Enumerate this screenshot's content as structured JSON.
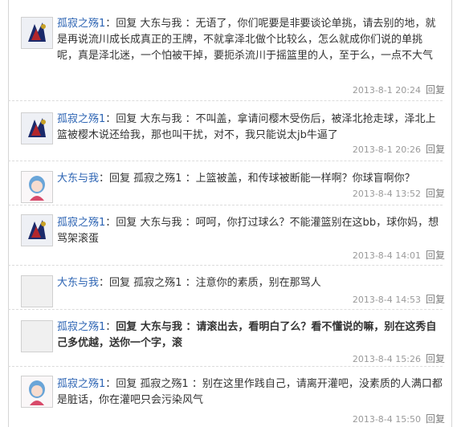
{
  "replies": [
    {
      "author": "孤寂之殇1",
      "text": "回复  大东与我 ：无语了，你们呢要是非要谈论单挑，请去别的地，就是再说流川成长成真正的王牌，不就拿泽北做个比较么，怎么就成你们说的单挑呢，真是泽北迷，一个怕被干掉，要扼杀流川于摇篮里的人，至于么，一点不大气",
      "time": "2013-8-1 20:24",
      "reply_label": "回复",
      "avatar": "art-avatar"
    },
    {
      "author": "孤寂之殇1",
      "text": "回复  大东与我 ：不叫盖，拿请问樱木受伤后，被泽北抢走球，泽北上篮被樱木说还给我，那也叫干扰，对不，我只能说太jb牛逼了",
      "time": "2013-8-1 20:26",
      "reply_label": "回复",
      "avatar": "art-avatar"
    },
    {
      "author": "大东与我",
      "text": "回复  孤寂之殇1 ：上篮被盖，和传球被断能一样啊？你球盲啊你？",
      "time": "2013-8-4 13:52",
      "reply_label": "回复",
      "avatar": "anime-avatar"
    },
    {
      "author": "孤寂之殇1",
      "text": "回复  大东与我 ：呵呵，你打过球么？不能灌篮别在这bb，球你妈，想骂架滚蛋",
      "time": "2013-8-4 14:01",
      "reply_label": "回复",
      "avatar": "art-avatar"
    },
    {
      "author": "大东与我",
      "text": "回复  孤寂之殇1 ：注意你的素质，别在那骂人",
      "time": "2013-8-4 14:53",
      "reply_label": "回复",
      "avatar": "default-avatar"
    },
    {
      "author": "孤寂之殇1",
      "text": "回复  大东与我 ：请滚出去，看明白了么？看不懂说的嘛，别在这秀自己多优越，送你一个字，滚",
      "time": "2013-8-4 15:26",
      "reply_label": "回复",
      "avatar": "default-avatar"
    },
    {
      "author": "孤寂之殇1",
      "text": "回复  孤寂之殇1 ：别在这里作践自己，请离开灌吧，没素质的人满口都是脏话，你在灌吧只会污染风气",
      "time": "2013-8-4 15:50",
      "reply_label": "回复",
      "avatar": "anime-avatar"
    }
  ]
}
